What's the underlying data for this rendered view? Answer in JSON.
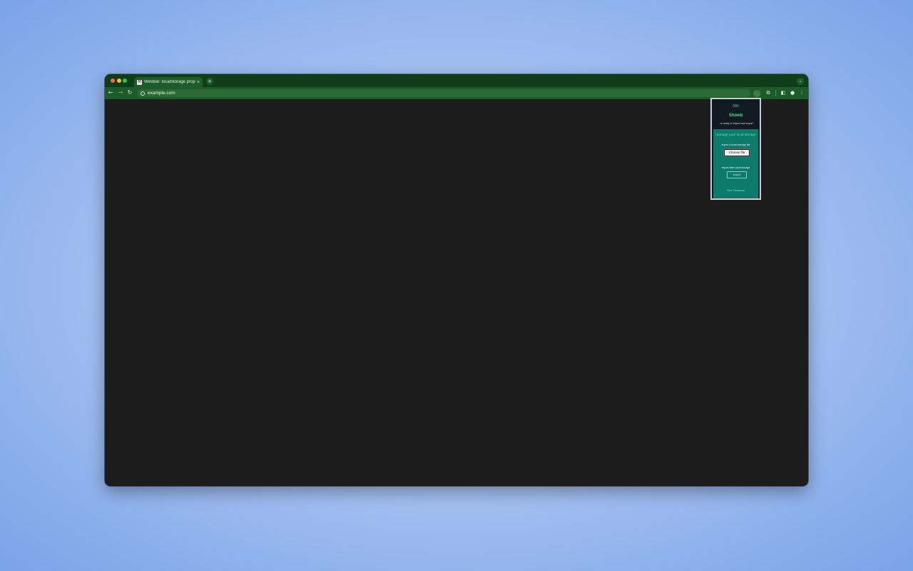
{
  "browser": {
    "tab": {
      "title": "Window: localStorage prope",
      "favicon": "M",
      "close": "×"
    },
    "new_tab": "+",
    "tab_search": "⌄",
    "nav": {
      "back": "←",
      "forward": "→",
      "reload": "↻"
    },
    "url": "example.com",
    "toolbar_icons": {
      "extensions": "⧉",
      "side_panel": "◧",
      "profile": "●",
      "menu": "⋮"
    }
  },
  "popup": {
    "logo": ":SW:",
    "brand": "Shweb",
    "tagline": "...is ready to import and export",
    "panel_title": "manage your local storage",
    "import_label": "import a local storage file",
    "choose_file_label": "Choose file",
    "export_label": "export sites local storage",
    "export_button": "export",
    "feedback": "Give Feedback"
  },
  "colors": {
    "tabbar": "#0f3d19",
    "toolbar": "#1e5b2a",
    "page_bg": "#1c1c1c",
    "popup_bg": "#111a22",
    "panel_bg": "#0e7a6c",
    "accent_green": "#4dd68b",
    "accent_teal": "#40f0c0"
  }
}
